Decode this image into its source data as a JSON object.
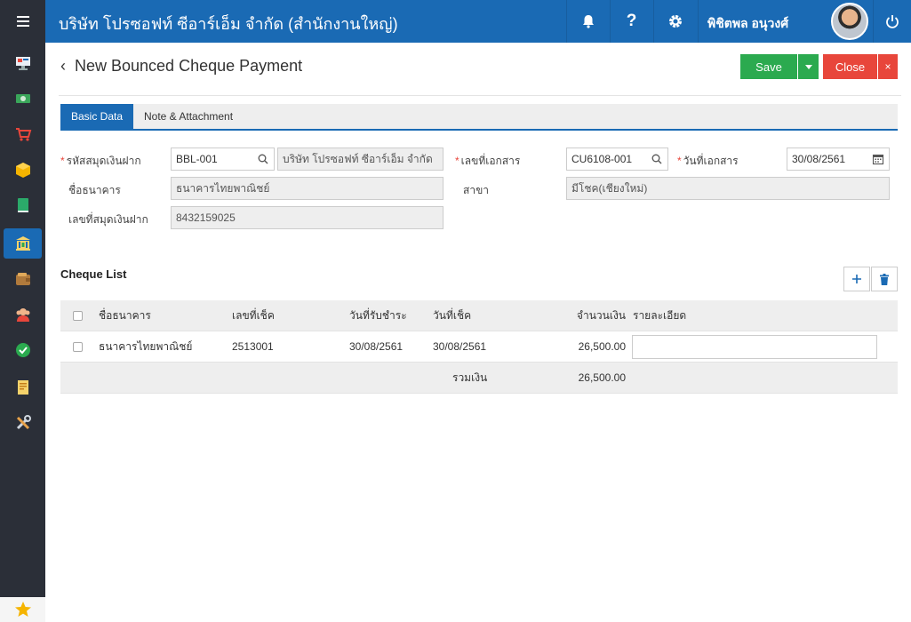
{
  "app": {
    "company": "บริษัท โปรซอฟท์ ซีอาร์เอ็ม จำกัด (สำนักงานใหญ่)",
    "user_name": "พิชิตพล อนุวงศ์"
  },
  "sidebar": {
    "items": [
      {
        "icon": "monitor-icon"
      },
      {
        "icon": "money-icon"
      },
      {
        "icon": "cart-icon"
      },
      {
        "icon": "box-icon"
      },
      {
        "icon": "book-icon"
      },
      {
        "icon": "bank-icon",
        "active": true
      },
      {
        "icon": "wallet-icon"
      },
      {
        "icon": "user-group-icon"
      },
      {
        "icon": "check-circle-icon"
      },
      {
        "icon": "document-icon"
      },
      {
        "icon": "tools-icon"
      }
    ],
    "favorite_icon": "star-icon"
  },
  "page": {
    "title": "New Bounced Cheque Payment",
    "save_label": "Save",
    "close_label": "Close"
  },
  "tabs": [
    {
      "label": "Basic Data",
      "active": true
    },
    {
      "label": "Note & Attachment",
      "active": false
    }
  ],
  "form": {
    "account_code_label": "รหัสสมุดเงินฝาก",
    "account_code_value": "BBL-001",
    "account_name_value": "บริษัท โปรซอฟท์ ซีอาร์เอ็ม จำกัด",
    "bank_name_label": "ชื่อธนาคาร",
    "bank_name_value": "ธนาคารไทยพาณิชย์",
    "account_no_label": "เลขที่สมุดเงินฝาก",
    "account_no_value": "8432159025",
    "doc_no_label": "เลขที่เอกสาร",
    "doc_no_value": "CU6108-001",
    "doc_date_label": "วันที่เอกสาร",
    "doc_date_value": "30/08/2561",
    "branch_label": "สาขา",
    "branch_value": "มีโชค(เชียงใหม่)"
  },
  "cheque_list": {
    "title": "Cheque List",
    "columns": {
      "bank": "ชื่อธนาคาร",
      "cheque_no": "เลขที่เช็ค",
      "received_date": "วันที่รับชำระ",
      "cheque_date": "วันที่เช็ค",
      "amount": "จำนวนเงิน",
      "detail": "รายละเอียด"
    },
    "rows": [
      {
        "bank": "ธนาคารไทยพาณิชย์",
        "cheque_no": "2513001",
        "received_date": "30/08/2561",
        "cheque_date": "30/08/2561",
        "amount": "26,500.00",
        "detail": ""
      }
    ],
    "total_label": "รวมเงิน",
    "total_value": "26,500.00"
  },
  "colors": {
    "primary": "#1a6ab4",
    "sidebar": "#2b2f38",
    "save": "#2baa4f",
    "close": "#e8463b"
  }
}
